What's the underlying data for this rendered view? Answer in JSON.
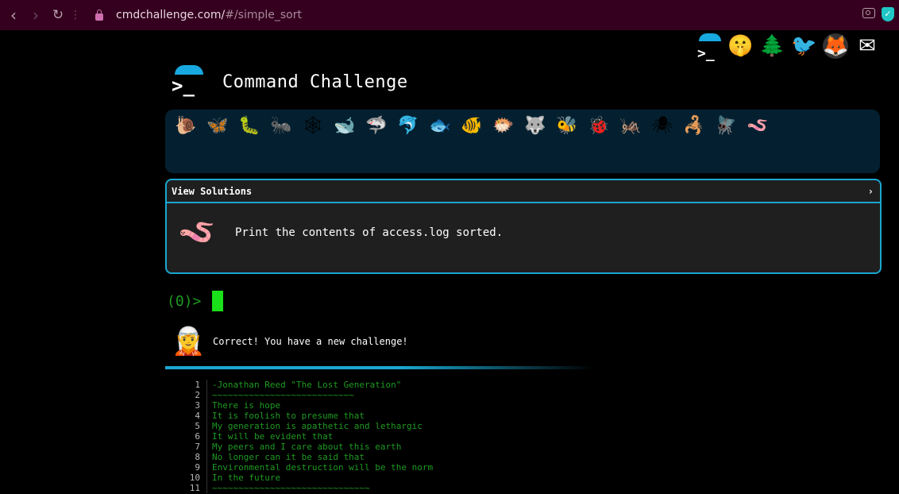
{
  "browser": {
    "url_host": "cmdchallenge.com/",
    "url_path": "#/simple_sort"
  },
  "top_icons": [
    {
      "name": "cmdchallenge-logo-icon",
      "glyph": ">_"
    },
    {
      "name": "shushing-face-icon",
      "glyph": "🤫"
    },
    {
      "name": "tree-icon",
      "glyph": "🌲"
    },
    {
      "name": "twitter-icon",
      "glyph": "🐦"
    },
    {
      "name": "gitlab-icon",
      "glyph": "🦊"
    },
    {
      "name": "mail-icon",
      "glyph": "✉"
    }
  ],
  "header": {
    "title": "Command Challenge"
  },
  "levels": [
    {
      "name": "snail-icon",
      "glyph": "🐌"
    },
    {
      "name": "butterfly-icon",
      "glyph": "🦋"
    },
    {
      "name": "caterpillar-icon",
      "glyph": "🐛"
    },
    {
      "name": "ant-icon",
      "glyph": "🐜"
    },
    {
      "name": "spiderweb-icon",
      "glyph": "🕸"
    },
    {
      "name": "whale-icon",
      "glyph": "🐋"
    },
    {
      "name": "shark-icon",
      "glyph": "🦈"
    },
    {
      "name": "dolphin-icon",
      "glyph": "🐬"
    },
    {
      "name": "fish-icon",
      "glyph": "🐟"
    },
    {
      "name": "tropical-fish-icon",
      "glyph": "🐠"
    },
    {
      "name": "blowfish-icon",
      "glyph": "🐡"
    },
    {
      "name": "wolf-icon",
      "glyph": "🐺"
    },
    {
      "name": "bee-icon",
      "glyph": "🐝"
    },
    {
      "name": "ladybug-icon",
      "glyph": "🐞"
    },
    {
      "name": "cricket-icon",
      "glyph": "🦗"
    },
    {
      "name": "spider-icon",
      "glyph": "🕷"
    },
    {
      "name": "scorpion-icon",
      "glyph": "🦂"
    },
    {
      "name": "fly-icon",
      "glyph": "🪰"
    },
    {
      "name": "worm-icon",
      "glyph": "🪱"
    }
  ],
  "solutions": {
    "header_label": "View Solutions",
    "chevron": "›",
    "worm_glyph": "🪱",
    "task": "Print the contents of access.log sorted."
  },
  "terminal": {
    "prompt": "(0)>"
  },
  "result": {
    "face_glyph": "🧝",
    "message": "Correct! You have a new challenge!"
  },
  "code_lines": [
    {
      "n": "1",
      "t": "-Jonathan Reed \"The Lost Generation\""
    },
    {
      "n": "2",
      "t": "~~~~~~~~~~~~~~~~~~~~~~~~~~~"
    },
    {
      "n": "3",
      "t": "There is hope"
    },
    {
      "n": "4",
      "t": "It is foolish to presume that"
    },
    {
      "n": "5",
      "t": "My generation is apathetic and lethargic"
    },
    {
      "n": "6",
      "t": "It will be evident that"
    },
    {
      "n": "7",
      "t": "My peers and I care about this earth"
    },
    {
      "n": "8",
      "t": "No longer can it be said that"
    },
    {
      "n": "9",
      "t": "Environmental destruction will be the norm"
    },
    {
      "n": "10",
      "t": "In the future"
    },
    {
      "n": "11",
      "t": "~~~~~~~~~~~~~~~~~~~~~~~~~~~~~~"
    }
  ]
}
